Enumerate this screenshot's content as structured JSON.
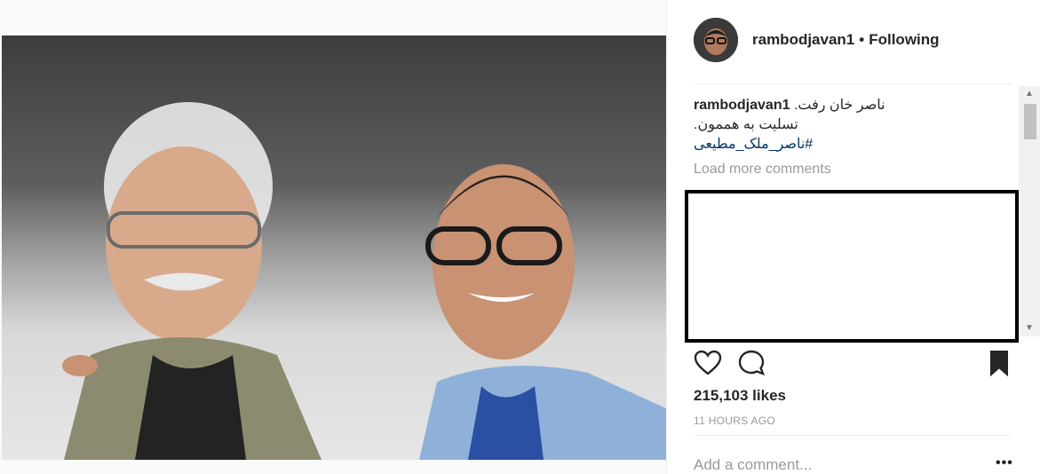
{
  "post": {
    "author": "rambodjavan1",
    "separator": "•",
    "follow_status": "Following",
    "caption_user": "rambodjavan1",
    "caption_line1": "ناصر خان رفت.",
    "caption_line2": "تسلیت به هممون.",
    "hashtag": "#ناصر_ملک_مطیعی",
    "load_more": "Load more comments",
    "likes": "215,103 likes",
    "timestamp": "11 HOURS AGO",
    "add_comment_placeholder": "Add a comment...",
    "more_label": "•••"
  },
  "icons": {
    "like": "heart-icon",
    "comment": "comment-icon",
    "save": "bookmark-icon",
    "scroll_up": "scroll-up-arrow",
    "scroll_down": "scroll-down-arrow"
  },
  "colors": {
    "hashtag": "#003569",
    "muted": "#999999",
    "text": "#262626"
  }
}
